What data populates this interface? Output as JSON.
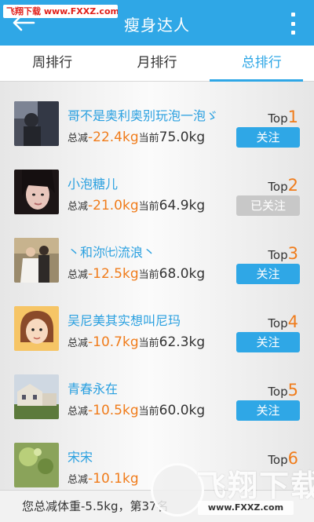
{
  "watermark_top": "飞翔下载 www.FXXZ.com",
  "header": {
    "title": "瘦身达人",
    "back_icon": "back-arrow-icon",
    "menu_icon": "overflow-menu-icon"
  },
  "tabs": [
    {
      "label": "周排行",
      "active": false
    },
    {
      "label": "月排行",
      "active": false
    },
    {
      "label": "总排行",
      "active": true
    }
  ],
  "stat_labels": {
    "loss_label": "总减",
    "current_label": "当前",
    "rank_prefix": "Top"
  },
  "users": [
    {
      "name": "哥不是奥利奥别玩泡一泡ゞ",
      "loss": "-22.4kg",
      "current": "75.0kg",
      "rank": "1",
      "follow": "关注",
      "followed": false
    },
    {
      "name": "小泡糖儿",
      "loss": "-21.0kg",
      "current": "64.9kg",
      "rank": "2",
      "follow": "已关注",
      "followed": true
    },
    {
      "name": "丶和沵㈦流浪丶",
      "loss": "-12.5kg",
      "current": "68.0kg",
      "rank": "3",
      "follow": "关注",
      "followed": false
    },
    {
      "name": "吴尼美其实想叫尼玛",
      "loss": "-10.7kg",
      "current": "62.3kg",
      "rank": "4",
      "follow": "关注",
      "followed": false
    },
    {
      "name": "青春永在",
      "loss": "-10.5kg",
      "current": "60.0kg",
      "rank": "5",
      "follow": "关注",
      "followed": false
    },
    {
      "name": "宋宋",
      "loss": "-10.1kg",
      "current": "",
      "rank": "6",
      "follow": "",
      "followed": false
    }
  ],
  "footer": {
    "summary": "您总减体重-5.5kg，第37名"
  },
  "watermark_logo": {
    "brand": "飞翔下载",
    "url": "www.FXXZ.com"
  },
  "colors": {
    "accent": "#2fa7e6",
    "orange": "#f07c1b",
    "disabled": "#c8c8c8"
  }
}
